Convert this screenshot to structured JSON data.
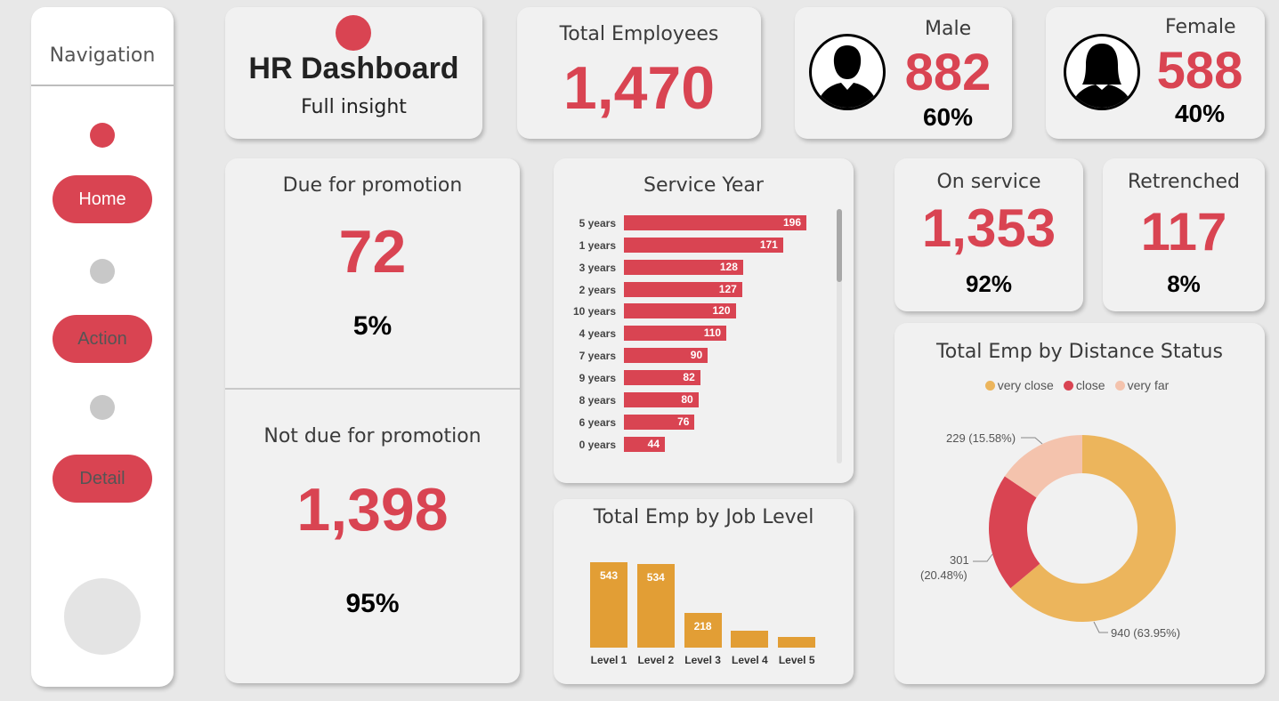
{
  "navigation": {
    "title": "Navigation",
    "buttons": [
      {
        "label": "Home",
        "text_color": "#ffffff",
        "dot_color": "#d94452"
      },
      {
        "label": "Action",
        "text_color": "#555555",
        "dot_color": "#c8c8c8"
      },
      {
        "label": "Detail",
        "text_color": "#555555",
        "dot_color": "#c8c8c8"
      }
    ]
  },
  "header": {
    "title": "HR Dashboard",
    "subtitle": "Full insight",
    "accent": "#d94452"
  },
  "kpis": {
    "total_employees": {
      "label": "Total Employees",
      "value": "1,470"
    },
    "male": {
      "label": "Male",
      "value": "882",
      "percent": "60%",
      "icon": "male-user-icon"
    },
    "female": {
      "label": "Female",
      "value": "588",
      "percent": "40%",
      "icon": "female-user-icon"
    },
    "on_service": {
      "label": "On service",
      "value": "1,353",
      "percent": "92%"
    },
    "retrenched": {
      "label": "Retrenched",
      "value": "117",
      "percent": "8%"
    }
  },
  "promotion": {
    "due": {
      "label": "Due for promotion",
      "value": "72",
      "percent": "5%"
    },
    "not_due": {
      "label": "Not due for promotion",
      "value": "1,398",
      "percent": "95%"
    }
  },
  "colors": {
    "accent": "#d94452",
    "orange": "#e29e35",
    "very_close": "#ecb55c",
    "close": "#d94452",
    "very_far": "#f4c3ad"
  },
  "chart_data": [
    {
      "type": "bar",
      "orientation": "horizontal",
      "title": "Service Year",
      "categories": [
        "5 years",
        "1 years",
        "3 years",
        "2 years",
        "10 years",
        "4 years",
        "7 years",
        "9 years",
        "8 years",
        "6 years",
        "0 years"
      ],
      "values": [
        196,
        171,
        128,
        127,
        120,
        110,
        90,
        82,
        80,
        76,
        44
      ],
      "xlim": [
        0,
        196
      ],
      "grid": false
    },
    {
      "type": "bar",
      "title": "Total Emp by Job Level",
      "categories": [
        "Level 1",
        "Level 2",
        "Level 3",
        "Level 4",
        "Level 5"
      ],
      "values": [
        543,
        534,
        218,
        106,
        69
      ],
      "data_labels": [
        "543",
        "534",
        "218",
        "",
        ""
      ],
      "ylim": [
        0,
        543
      ],
      "grid": false
    },
    {
      "type": "pie",
      "style": "donut",
      "title": "Total Emp by Distance Status",
      "legend_position": "top",
      "categories": [
        "very close",
        "close",
        "very far"
      ],
      "values": [
        940,
        301,
        229
      ],
      "percents": [
        "63.95%",
        "20.48%",
        "15.58%"
      ],
      "data_labels": [
        "940 (63.95%)",
        "301",
        "(20.48%)",
        "229 (15.58%)"
      ]
    }
  ]
}
